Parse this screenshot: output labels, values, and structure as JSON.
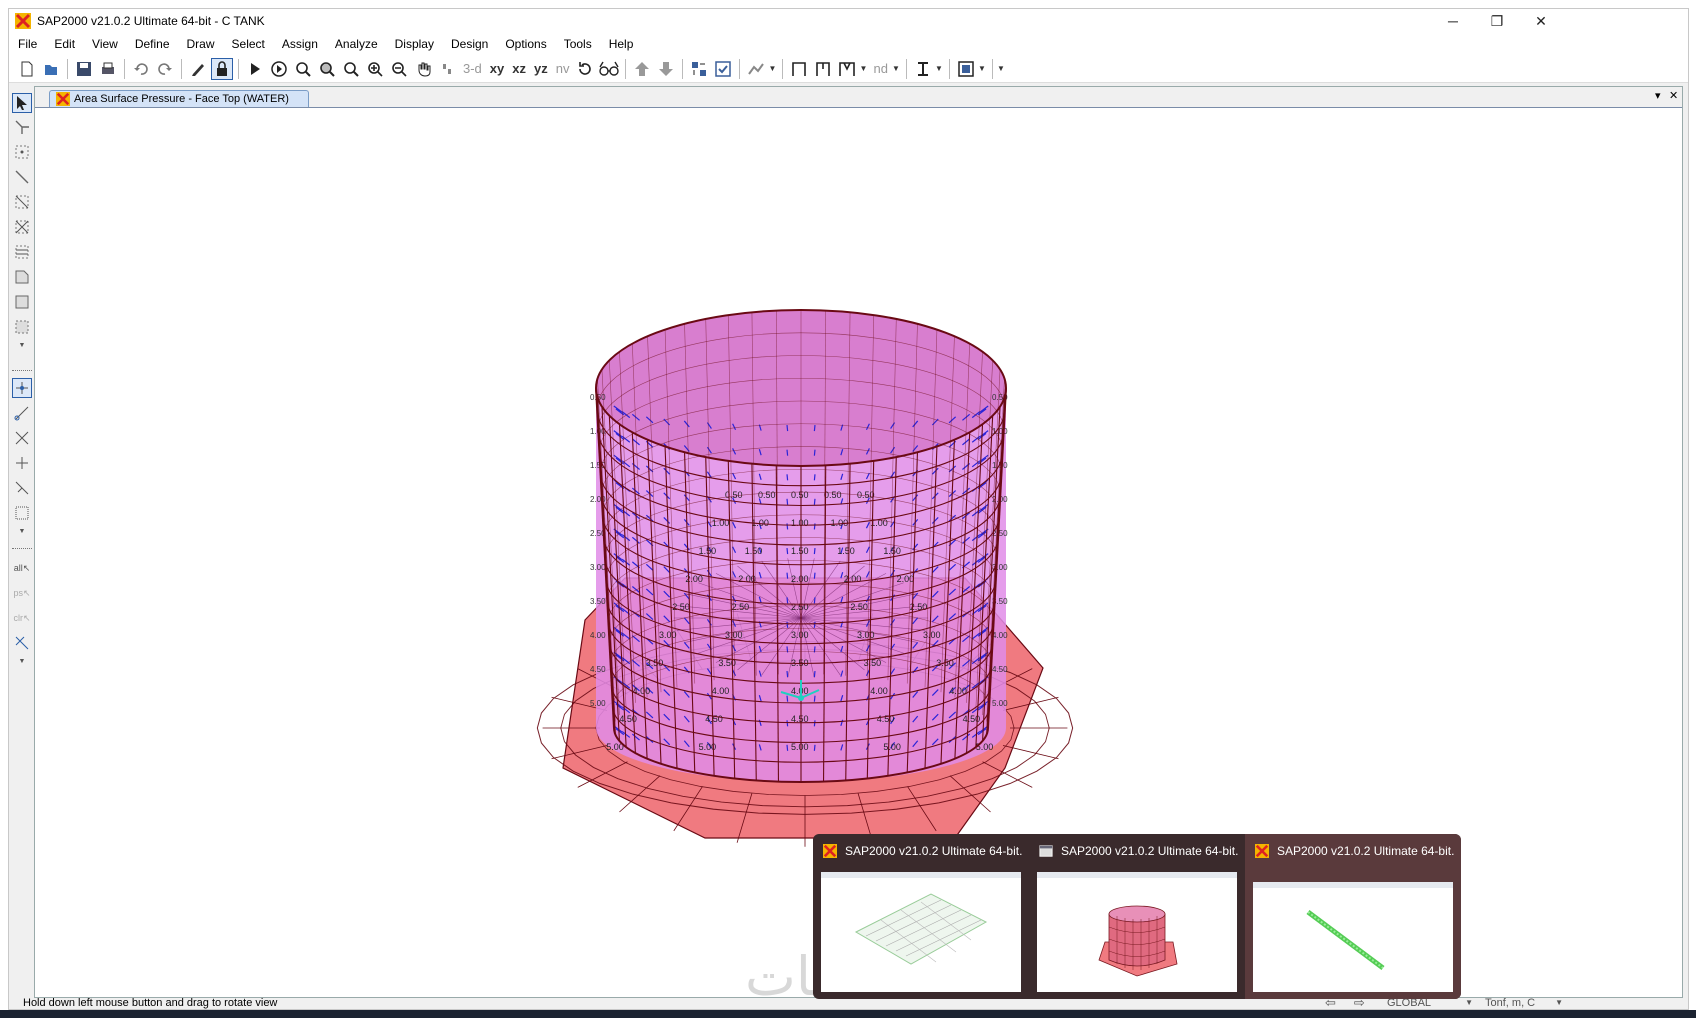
{
  "window": {
    "title": "SAP2000 v21.0.2 Ultimate 64-bit - C TANK",
    "minimize": "─",
    "restore": "❐",
    "close": "✕"
  },
  "menus": [
    "File",
    "Edit",
    "View",
    "Define",
    "Draw",
    "Select",
    "Assign",
    "Analyze",
    "Display",
    "Design",
    "Options",
    "Tools",
    "Help"
  ],
  "toolbar": {
    "view_3d": "3-d",
    "view_xy": "xy",
    "view_xz": "xz",
    "view_yz": "yz",
    "view_nv": "nv",
    "view_nd": "nd"
  },
  "document": {
    "tab_title": "Area Surface Pressure - Face Top (WATER)",
    "dropdown_glyph": "▾",
    "close_glyph": "✕"
  },
  "tank_labels": [
    "0.50",
    "1.00",
    "1.50",
    "2.00",
    "2.50",
    "3.00",
    "3.50",
    "4.00",
    "4.50",
    "5.00"
  ],
  "status": {
    "message": "Hold down left mouse button and drag to rotate view",
    "coord_system": "GLOBAL",
    "units": "Tonf, m, C"
  },
  "taskbar_previews": [
    {
      "title": "SAP2000 v21.0.2 Ultimate 64-bit...",
      "active": false
    },
    {
      "title": "SAP2000 v21.0.2 Ultimate 64-bit...",
      "active": false
    },
    {
      "title": "SAP2000 v21.0.2 Ultimate 64-bit...",
      "active": true
    }
  ],
  "watermark": "خمسات",
  "colors": {
    "mesh_fill": "#f07a80",
    "mesh_line": "#6a0a14",
    "inner_fill": "#e08ce8",
    "pressure_arrow": "#2a24d8",
    "axis": "#1fd0c0"
  }
}
